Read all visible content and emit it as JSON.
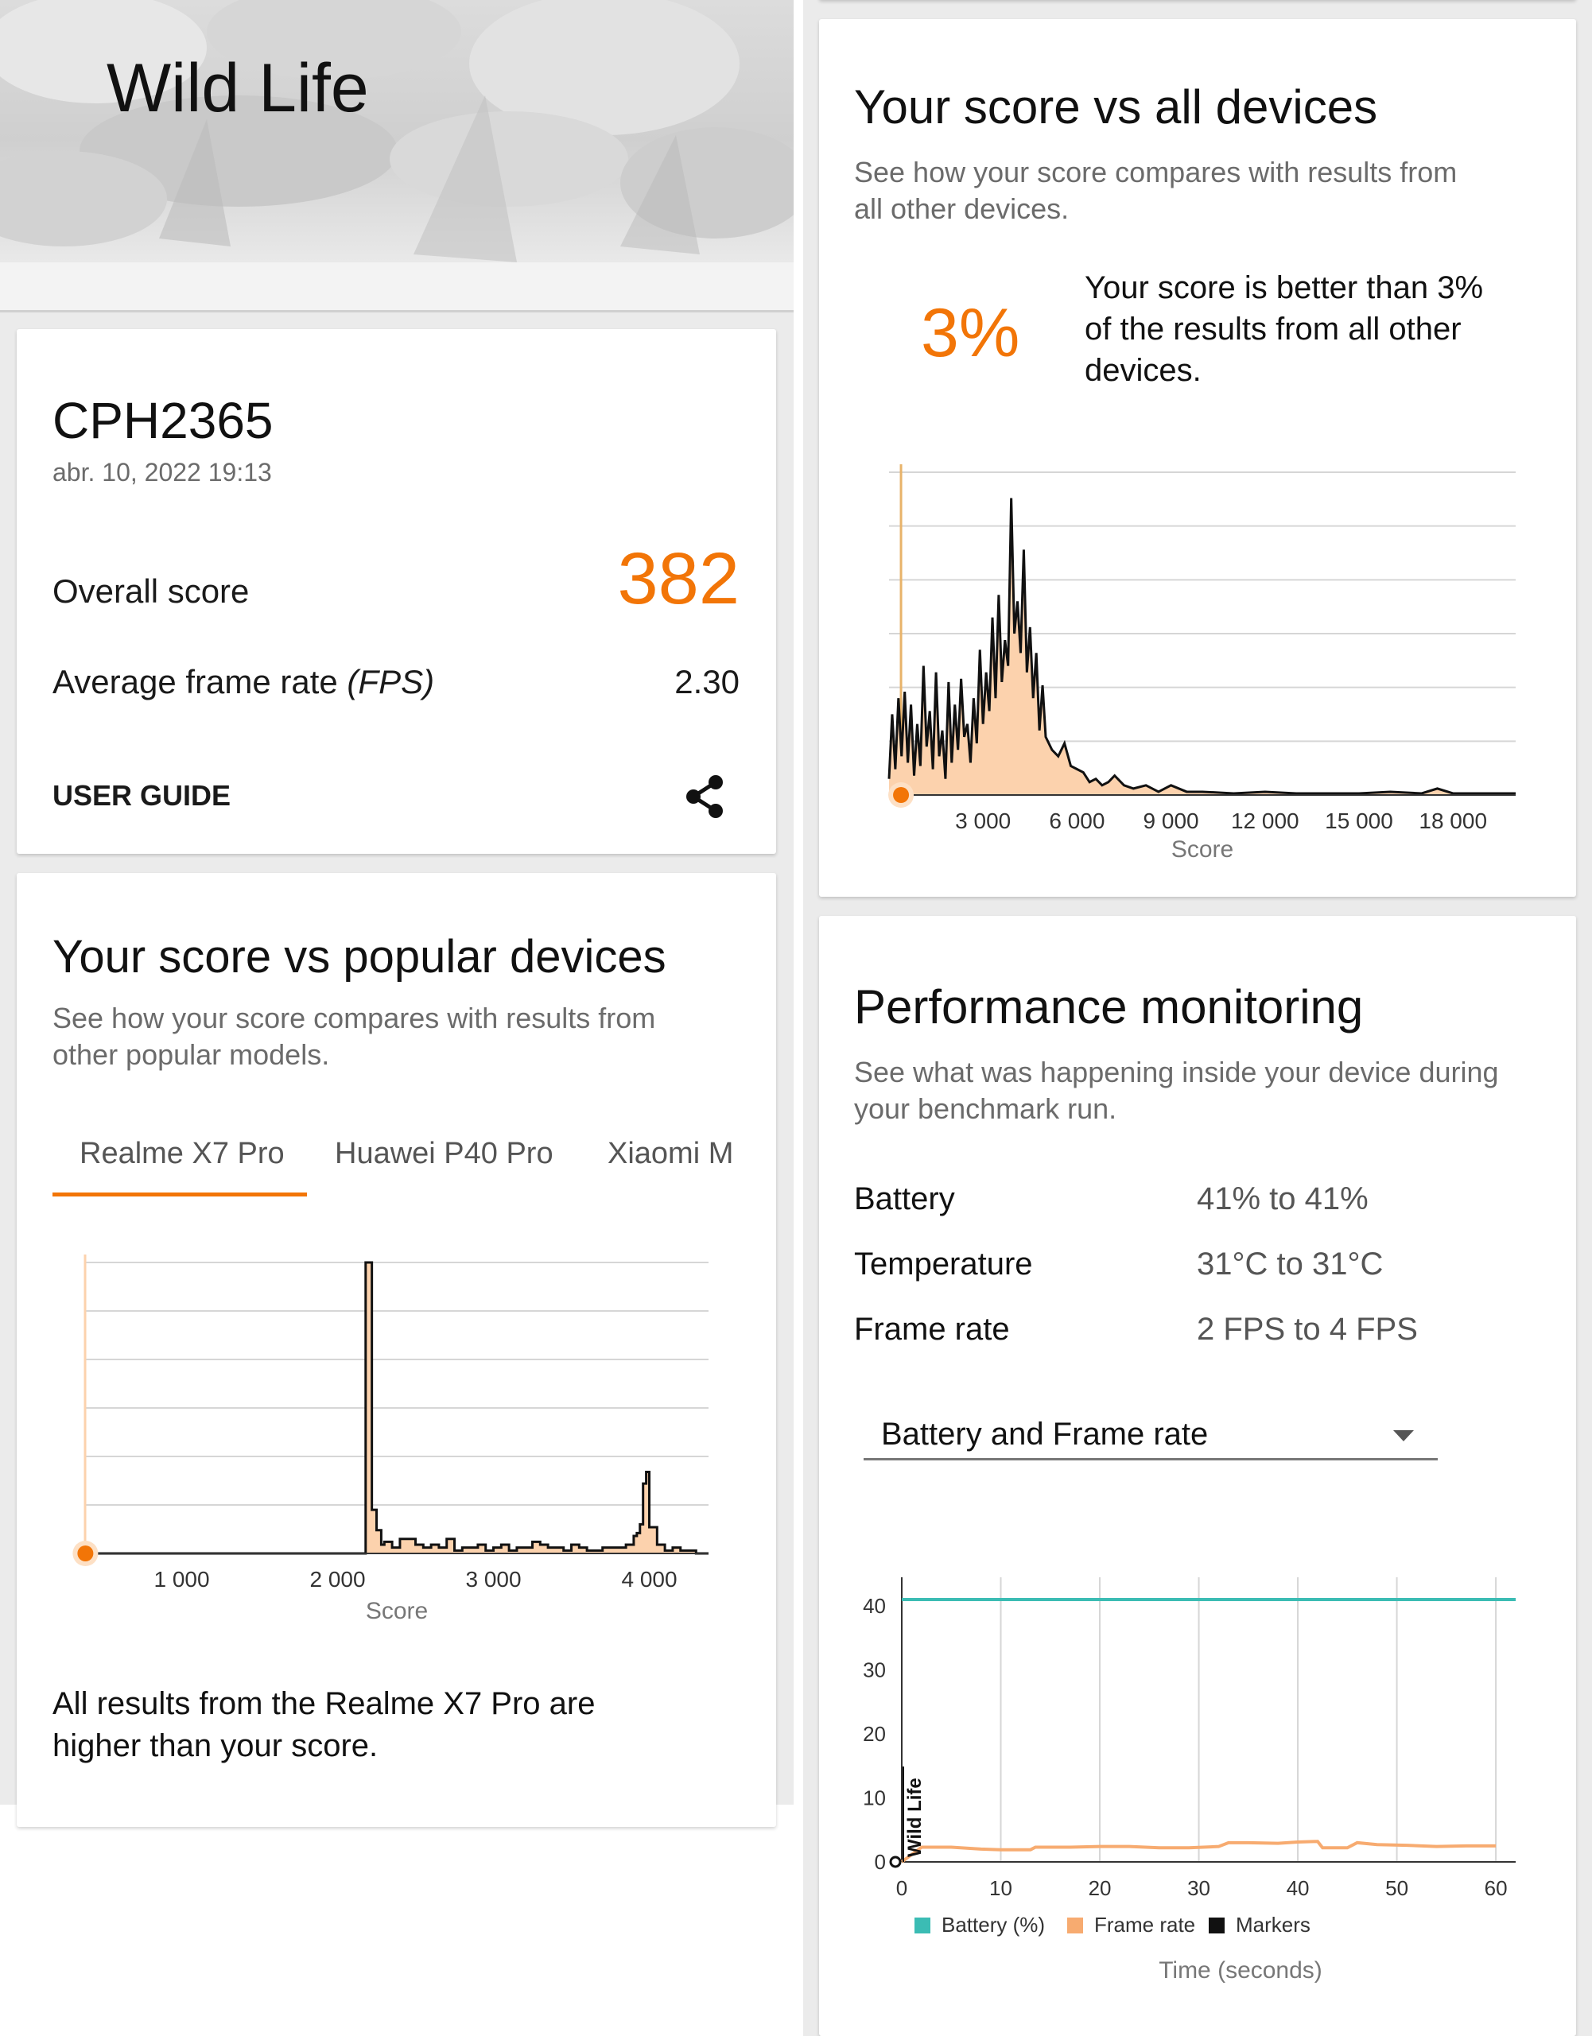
{
  "hero": {
    "title": "Wild Life"
  },
  "result": {
    "device": "CPH2365",
    "timestamp": "abr. 10, 2022 19:13",
    "overall_label": "Overall score",
    "overall_value": "382",
    "fps_label_prefix": "Average frame rate ",
    "fps_label_unit": "(FPS)",
    "fps_value": "2.30",
    "user_guide_label": "USER GUIDE",
    "share_icon": "share-icon"
  },
  "popular": {
    "title": "Your score vs popular devices",
    "subtitle_line1": "See how your score compares with results from",
    "subtitle_line2": "other popular models.",
    "tabs": [
      "Realme X7 Pro",
      "Huawei P40 Pro",
      "Xiaomi M"
    ],
    "active_tab": 0,
    "footer_line1": "All results from the Realme X7 Pro are",
    "footer_line2": "higher than your score."
  },
  "alldevices": {
    "title": "Your score vs all devices",
    "subtitle_line1": "See how your score compares with results from",
    "subtitle_line2": "all other devices.",
    "percent": "3%",
    "desc_line1": "Your score is better than 3%",
    "desc_line2": "of the results from all other",
    "desc_line3": "devices."
  },
  "performance": {
    "title": "Performance monitoring",
    "subtitle_line1": "See what was happening inside your device during",
    "subtitle_line2": "your benchmark run.",
    "rows": [
      {
        "label": "Battery",
        "value": "41% to 41%"
      },
      {
        "label": "Temperature",
        "value": "31°C to 31°C"
      },
      {
        "label": "Frame rate",
        "value": "2 FPS to 4 FPS"
      }
    ],
    "dropdown_value": "Battery and Frame rate"
  },
  "colors": {
    "accent": "#f27507",
    "fill": "#fcd2ad",
    "battery": "#3bbcb4",
    "framerate": "#f7ab70",
    "grid": "#d6d6d6"
  },
  "chart_data": [
    {
      "type": "area",
      "name": "popular-devices-distribution",
      "xlabel": "Score",
      "x_ticks": [
        "1 000",
        "2 000",
        "3 000",
        "4 000"
      ],
      "xlim": [
        380,
        4380
      ],
      "your_score": 382,
      "x": [
        380,
        2150,
        2180,
        2200,
        2220,
        2250,
        2280,
        2300,
        2350,
        2400,
        2450,
        2500,
        2550,
        2600,
        2650,
        2700,
        2750,
        2800,
        2850,
        2900,
        2950,
        3000,
        3050,
        3100,
        3150,
        3200,
        3250,
        3300,
        3350,
        3400,
        3450,
        3500,
        3550,
        3600,
        3650,
        3700,
        3750,
        3800,
        3850,
        3900,
        3920,
        3940,
        3960,
        3980,
        4000,
        4050,
        4100,
        4150,
        4200,
        4250,
        4300,
        4380
      ],
      "y": [
        0,
        0,
        100,
        100,
        15,
        8,
        3,
        4,
        2,
        5,
        5,
        3,
        2,
        3,
        2,
        5,
        1,
        2,
        2,
        3,
        1,
        2,
        3,
        1,
        2,
        2,
        4,
        3,
        2,
        2,
        1,
        3,
        2,
        1,
        1,
        2,
        2,
        2,
        3,
        6,
        7,
        10,
        24,
        28,
        9,
        3,
        1,
        2,
        1,
        1,
        0,
        0
      ]
    },
    {
      "type": "area",
      "name": "all-devices-distribution",
      "xlabel": "Score",
      "x_ticks": [
        "3 000",
        "6 000",
        "9 000",
        "12 000",
        "15 000",
        "18 000"
      ],
      "xlim": [
        0,
        20000
      ],
      "your_score": 382,
      "x": [
        0,
        100,
        200,
        300,
        400,
        500,
        600,
        700,
        800,
        900,
        1000,
        1100,
        1200,
        1300,
        1400,
        1500,
        1600,
        1700,
        1800,
        1900,
        2000,
        2100,
        2200,
        2300,
        2400,
        2500,
        2600,
        2700,
        2800,
        2900,
        3000,
        3100,
        3200,
        3300,
        3400,
        3500,
        3600,
        3700,
        3800,
        3900,
        4000,
        4100,
        4200,
        4300,
        4400,
        4500,
        4600,
        4700,
        4800,
        4900,
        5000,
        5200,
        5400,
        5600,
        5800,
        6000,
        6200,
        6400,
        6600,
        6800,
        7000,
        7200,
        7500,
        7800,
        8200,
        8600,
        9000,
        9500,
        10000,
        11000,
        12000,
        13000,
        14000,
        15000,
        16000,
        17000,
        17500,
        18000,
        18500,
        19000,
        20000
      ],
      "y": [
        5,
        25,
        8,
        30,
        12,
        32,
        10,
        28,
        6,
        22,
        9,
        40,
        15,
        26,
        8,
        38,
        12,
        20,
        5,
        35,
        10,
        28,
        14,
        36,
        18,
        22,
        10,
        30,
        16,
        45,
        22,
        38,
        26,
        55,
        30,
        62,
        35,
        48,
        40,
        92,
        50,
        60,
        44,
        76,
        38,
        52,
        30,
        44,
        20,
        34,
        18,
        14,
        12,
        16,
        9,
        8,
        7,
        4,
        5,
        3,
        4,
        6,
        3,
        2,
        3,
        1,
        3,
        1,
        1,
        0.5,
        1,
        0.5,
        0.5,
        0.5,
        1,
        0.5,
        2,
        0.5,
        0.5,
        0.5,
        0.5
      ]
    },
    {
      "type": "line",
      "name": "performance-monitoring",
      "xlabel": "Time (seconds)",
      "xlim": [
        0,
        62
      ],
      "ylim": [
        0,
        40
      ],
      "x_ticks": [
        0,
        10,
        20,
        30,
        40,
        50,
        60
      ],
      "y_ticks": [
        0,
        10,
        20,
        30,
        40
      ],
      "marker_label": "Wild Life",
      "legend": [
        "Battery (%)",
        "Frame rate",
        "Markers"
      ],
      "series": [
        {
          "name": "Battery (%)",
          "x": [
            0,
            62
          ],
          "y": [
            41,
            41
          ]
        },
        {
          "name": "Frame rate",
          "x": [
            0,
            2,
            5,
            8,
            10,
            13,
            13.5,
            17,
            20,
            23,
            26,
            29,
            32,
            33,
            35,
            38,
            40,
            42,
            42.5,
            45,
            46,
            48,
            51,
            54,
            57,
            60
          ],
          "y": [
            0,
            2.3,
            2.3,
            2.0,
            1.9,
            1.9,
            2.3,
            2.3,
            2.4,
            2.4,
            2.2,
            2.2,
            2.4,
            3.0,
            3.0,
            2.9,
            3.1,
            3.2,
            2.2,
            2.2,
            3.0,
            2.7,
            2.6,
            2.4,
            2.5,
            2.5
          ]
        }
      ]
    }
  ]
}
